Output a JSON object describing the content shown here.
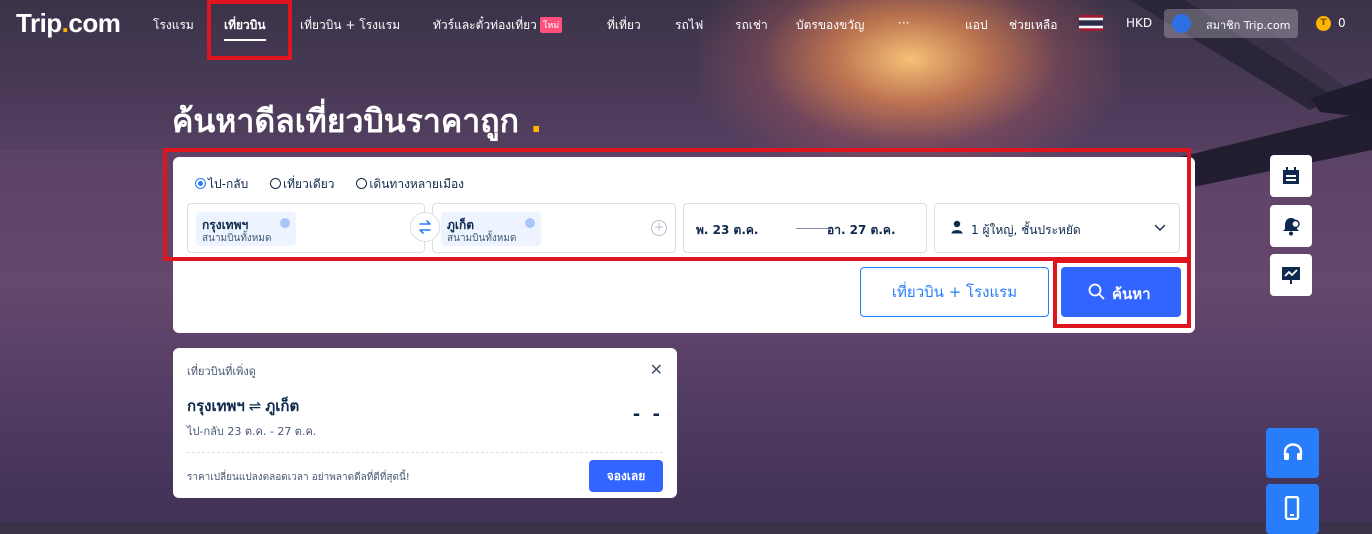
{
  "colors": {
    "brand_blue": "#3264ff",
    "accent_yellow": "#ffb400",
    "annotation_red": "#e0141e",
    "text_dark": "#0f294d"
  },
  "nav": {
    "logo_main": "Trip",
    "logo_dot": ".",
    "logo_tail": "com",
    "items": [
      {
        "label": "โรงแรม"
      },
      {
        "label": "เที่ยวบิน",
        "active": true
      },
      {
        "label": "เที่ยวบิน + โรงแรม"
      },
      {
        "label": "ทัวร์และตั๋วท่องเที่ยว",
        "badge": "ใหม่"
      },
      {
        "label": "ที่เที่ยว"
      },
      {
        "label": "รถไฟ"
      },
      {
        "label": "รถเช่า"
      },
      {
        "label": "บัตรของขวัญ"
      },
      {
        "label": "···"
      }
    ],
    "app": "แอป",
    "help": "ช่วยเหลือ",
    "currency": "HKD",
    "member": "สมาชิก Trip.com",
    "coin_symbol": "T",
    "coins": "0"
  },
  "hero": {
    "title": "ค้นหาดีลเที่ยวบินราคาถูก",
    "dot": "."
  },
  "search": {
    "trip_types": [
      {
        "label": "ไป-กลับ",
        "checked": true
      },
      {
        "label": "เที่ยวเดียว",
        "checked": false
      },
      {
        "label": "เดินทางหลายเมือง",
        "checked": false
      }
    ],
    "from": {
      "city": "กรุงเทพฯ",
      "airport": "สนามบินทั้งหมด"
    },
    "to": {
      "city": "ภูเก็ต",
      "airport": "สนามบินทั้งหมด"
    },
    "depart": "พ. 23 ต.ค.",
    "return": "อา. 27 ต.ค.",
    "passengers": "1 ผู้ใหญ่, ชั้นประหยัด",
    "bundle_button": "เที่ยวบิน + โรงแรม",
    "search_button": "ค้นหา"
  },
  "recent": {
    "heading": "เที่ยวบินที่เพิ่งดู",
    "from": "กรุงเทพฯ",
    "arrow": "⇌",
    "to": "ภูเก็ต",
    "details": "ไป-กลับ 23 ต.ค. - 27 ต.ค.",
    "price": "- -",
    "note": "ราคาเปลี่ยนแปลงตลอดเวลา อย่าพลาดดีลที่ดีที่สุดนี้!",
    "book_button": "จองเลย"
  }
}
